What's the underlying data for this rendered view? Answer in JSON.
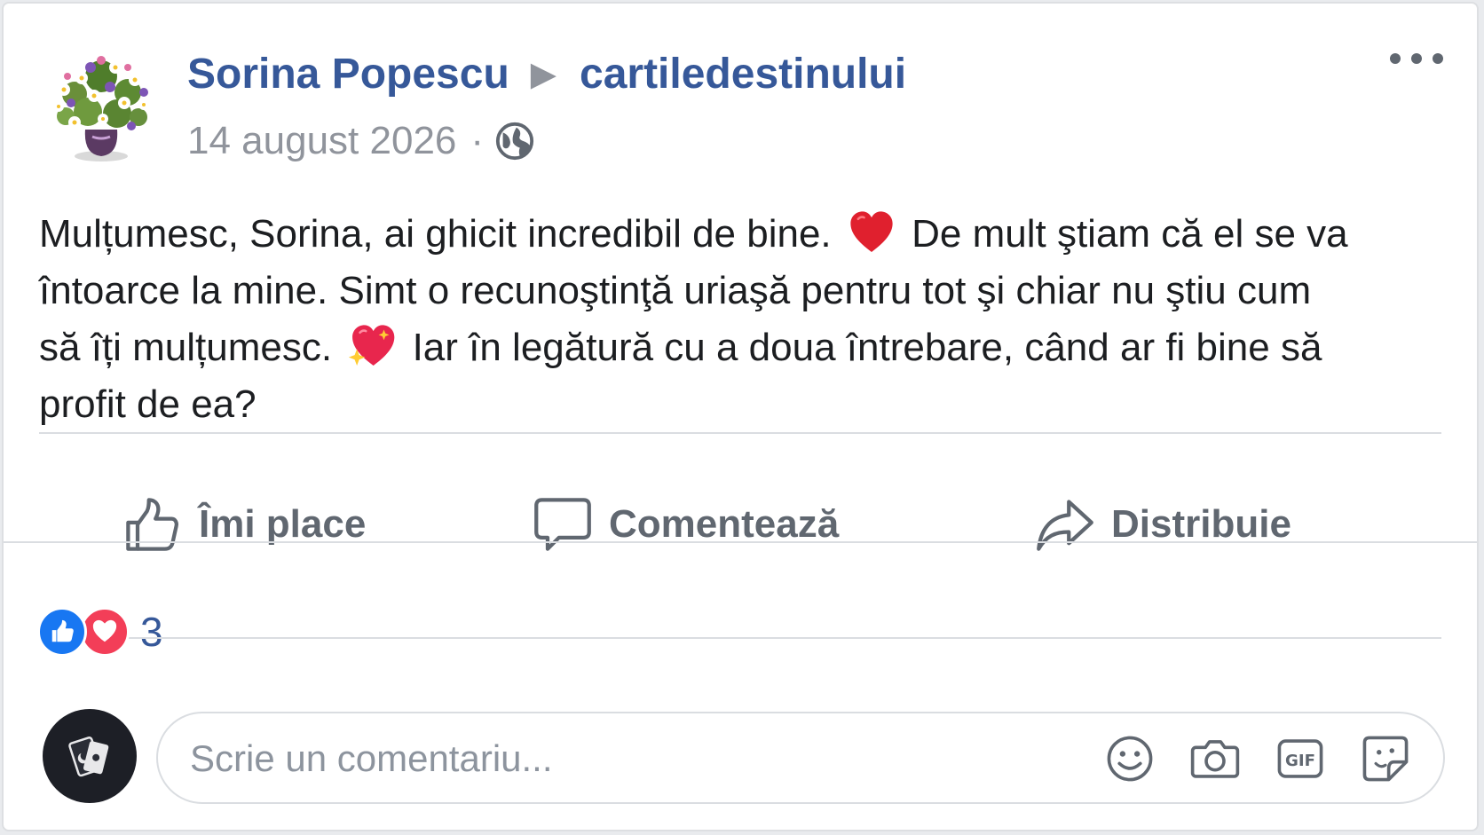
{
  "post": {
    "author": "Sorina Popescu",
    "arrow": "▶",
    "target": "cartiledestinului",
    "date": "14 august 2026",
    "separator": "·",
    "privacy_icon": "globe-icon",
    "more_icon": "more-options-icon",
    "text": {
      "line1_a": "Mulțumesc, Sorina, ai ghicit incredibil de bine.",
      "line1_b": "De mult ştiam că el se va",
      "line2": "întoarce la mine. Simt o recunoştinţă uriaşă pentru tot şi chiar nu ştiu cum",
      "line3_a": "să îți mulțumesc.",
      "line3_b": "Iar în legătură cu a doua întrebare, când ar fi bine să",
      "line4": "profit de ea?",
      "emoji1": "red-heart-emoji",
      "emoji2": "sparkling-heart-emoji"
    }
  },
  "actions": {
    "like": "Îmi place",
    "comment": "Comentează",
    "share": "Distribuie"
  },
  "reactions": {
    "types": [
      "like",
      "love"
    ],
    "count": "3"
  },
  "comment": {
    "placeholder": "Scrie un comentariu...",
    "icons": [
      "emoji-icon",
      "camera-icon",
      "gif-icon",
      "sticker-icon"
    ]
  },
  "colors": {
    "link": "#365899",
    "muted": "#90949c",
    "action": "#606770",
    "like_blue": "#1877f2",
    "love_red": "#f33e58"
  }
}
